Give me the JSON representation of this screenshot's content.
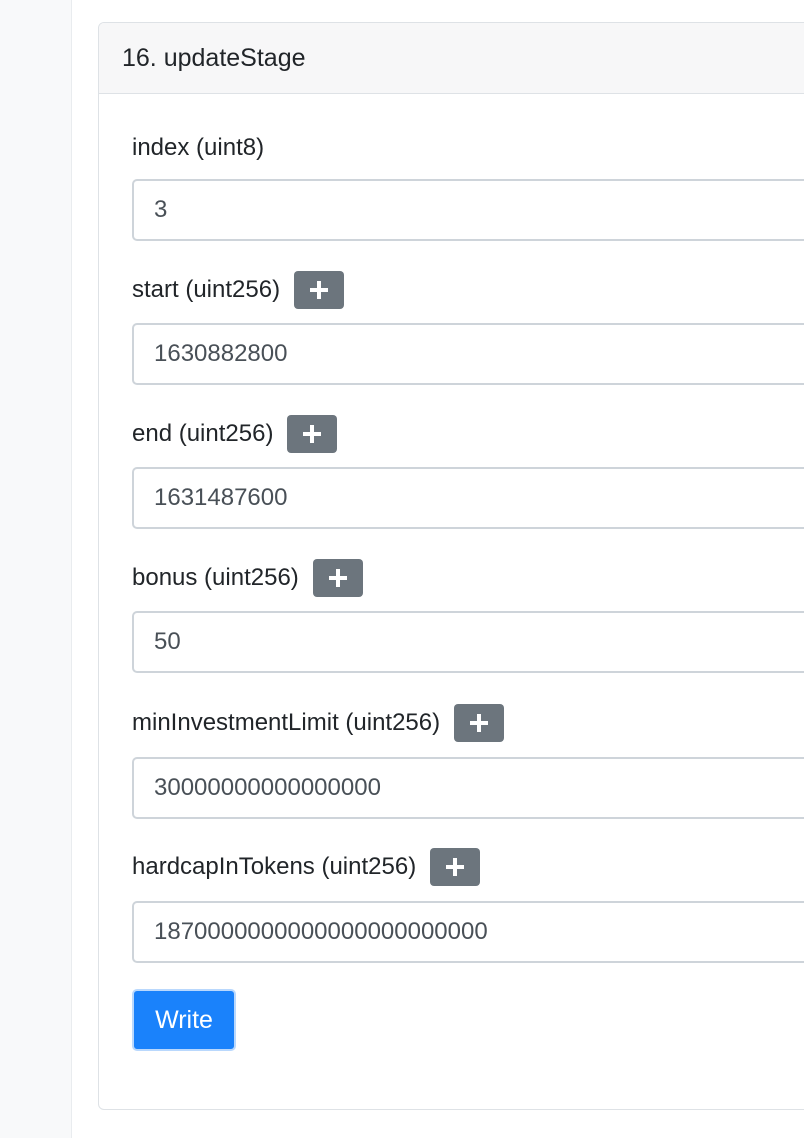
{
  "function": {
    "title": "16. updateStage",
    "write_label": "Write"
  },
  "fields": [
    {
      "label": "index (uint8)",
      "value": "3",
      "has_plus": false
    },
    {
      "label": "start (uint256)",
      "value": "1630882800",
      "has_plus": true
    },
    {
      "label": "end (uint256)",
      "value": "1631487600",
      "has_plus": true
    },
    {
      "label": "bonus (uint256)",
      "value": "50",
      "has_plus": true
    },
    {
      "label": "minInvestmentLimit (uint256)",
      "value": "30000000000000000",
      "has_plus": true
    },
    {
      "label": "hardcapInTokens (uint256)",
      "value": "1870000000000000000000000",
      "has_plus": true
    }
  ],
  "icons": {
    "plus": "plus-icon"
  },
  "colors": {
    "plus_button": "#6c757d",
    "write_button": "#1a82fb"
  }
}
